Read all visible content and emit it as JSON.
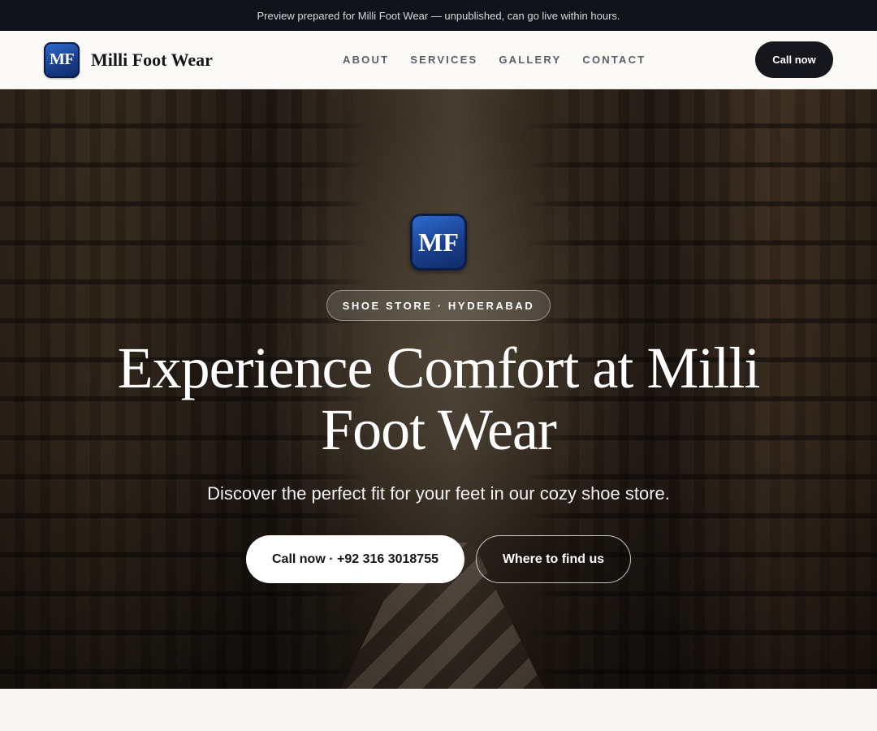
{
  "banner": {
    "text": "Preview prepared for Milli Foot Wear — unpublished, can go live within hours."
  },
  "header": {
    "logo_text": "MF",
    "brand_name": "Milli Foot Wear",
    "nav": [
      {
        "label": "ABOUT"
      },
      {
        "label": "SERVICES"
      },
      {
        "label": "GALLERY"
      },
      {
        "label": "CONTACT"
      }
    ],
    "call_label": "Call now"
  },
  "hero": {
    "logo_text": "MF",
    "tag": "SHOE STORE · HYDERABAD",
    "headline": "Experience Comfort at Milli Foot Wear",
    "subtitle": "Discover the perfect fit for your feet in our cozy shoe store.",
    "primary_cta": "Call now · +92 316 3018755",
    "secondary_cta": "Where to find us"
  },
  "colors": {
    "dark": "#101318",
    "logo_blue": "#1a3f8e",
    "page_bg": "#f8f7f4"
  }
}
